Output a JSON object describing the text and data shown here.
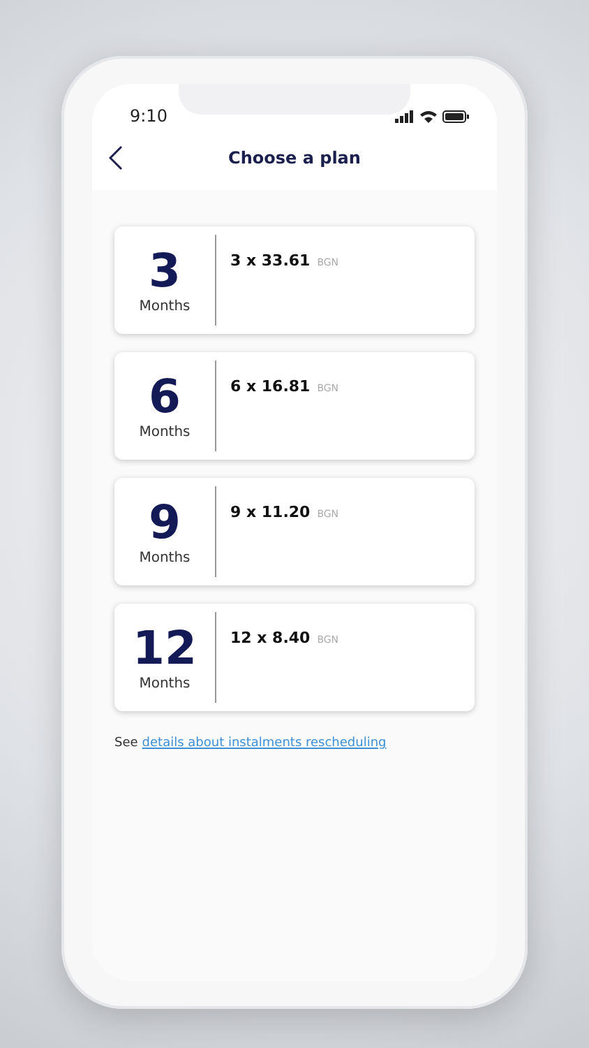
{
  "status_bar": {
    "time": "9:10"
  },
  "header": {
    "title": "Choose a plan"
  },
  "plans": [
    {
      "number": "3",
      "unit": "Months",
      "amount": "3 x 33.61",
      "currency": "BGN"
    },
    {
      "number": "6",
      "unit": "Months",
      "amount": "6 x 16.81",
      "currency": "BGN"
    },
    {
      "number": "9",
      "unit": "Months",
      "amount": "9 x 11.20",
      "currency": "BGN"
    },
    {
      "number": "12",
      "unit": "Months",
      "amount": "12 x 8.40",
      "currency": "BGN"
    }
  ],
  "footnote": {
    "text": "See",
    "link": "details about instalments rescheduling"
  }
}
